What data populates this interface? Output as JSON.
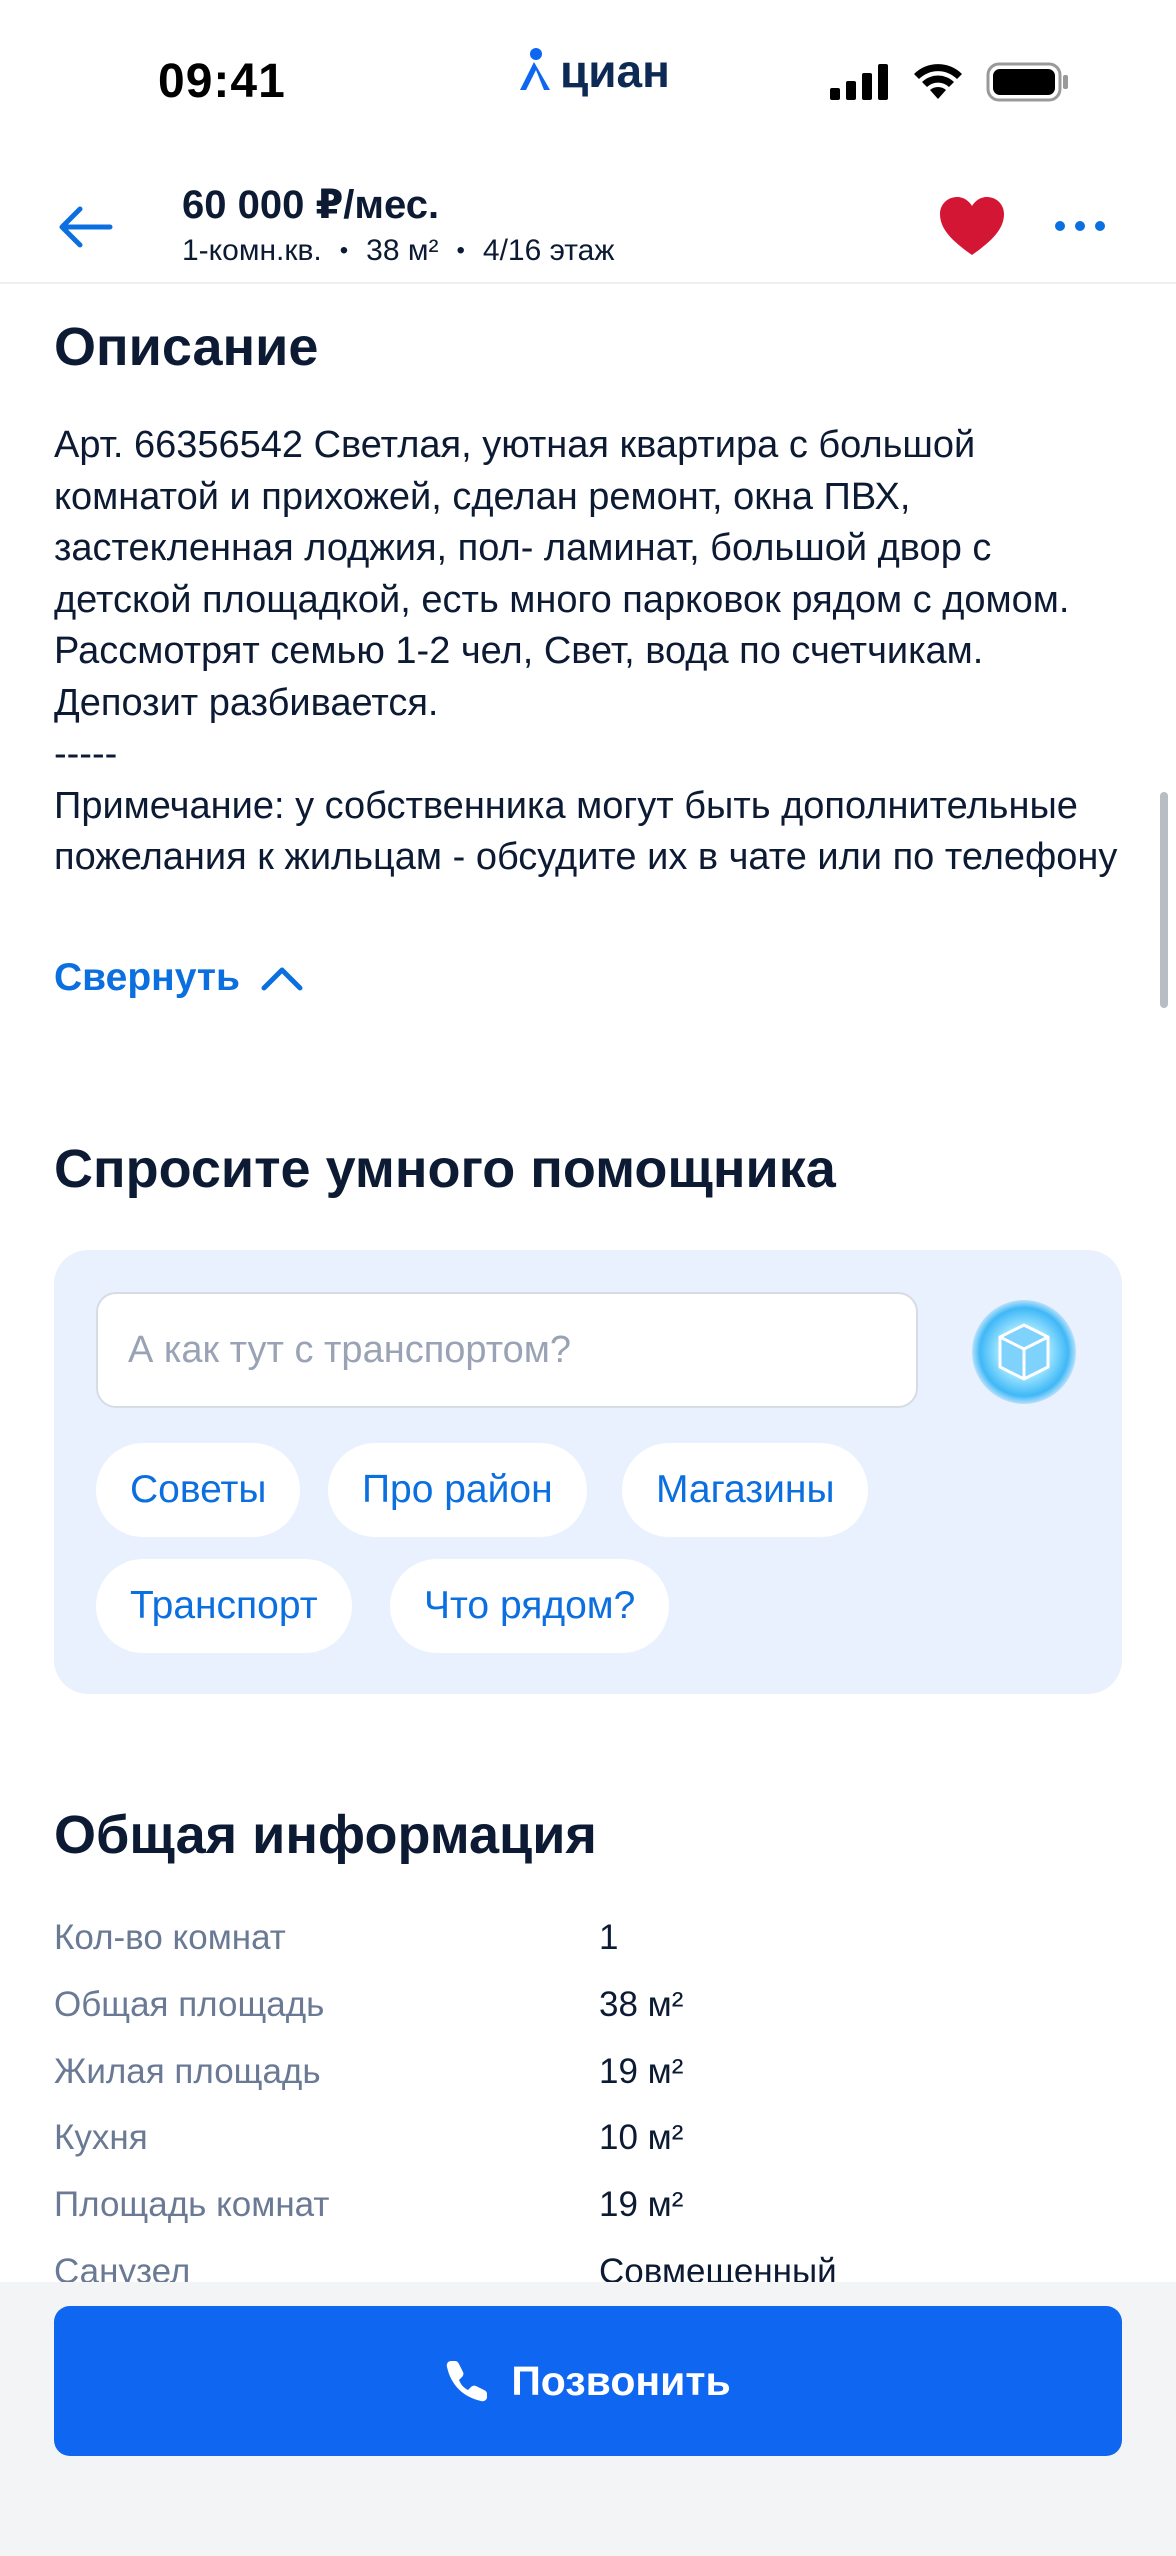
{
  "status_bar": {
    "time": "09:41",
    "brand": "циан"
  },
  "header": {
    "price": "60 000 ₽/мес.",
    "rooms": "1-комн.кв.",
    "area": "38 м²",
    "floor": "4/16 этаж"
  },
  "description": {
    "title": "Описание",
    "text": "Арт. 66356542 Светлая, уютная квартира с большой комнатой и прихожей, сделан ремонт, окна ПВХ, застекленная лоджия, пол- ламинат, большой двор с детской площадкой, есть много парковок рядом с домом. Рассмотрят семью 1-2 чел,  Свет, вода по счетчикам. Депозит разбивается.\n-----\nПримечание: у собственника могут быть дополнительные пожелания к жильцам - обсудите их в чате или по телефону",
    "collapse_label": "Свернуть"
  },
  "assistant": {
    "title": "Спросите умного помощника",
    "input_placeholder": "А как тут с транспортом?",
    "chips": [
      "Советы",
      "Про район",
      "Магазины",
      "Транспорт",
      "Что рядом?"
    ]
  },
  "general_info": {
    "title": "Общая информация",
    "rows": [
      {
        "key": "Кол-во комнат",
        "value": "1"
      },
      {
        "key": "Общая площадь",
        "value": "38 м²"
      },
      {
        "key": "Жилая площадь",
        "value": "19 м²"
      },
      {
        "key": "Кухня",
        "value": "10 м²"
      },
      {
        "key": "Площадь комнат",
        "value": "19 м²"
      },
      {
        "key": "Санузел",
        "value": "Совмещенный"
      }
    ]
  },
  "call_button": {
    "label": "Позвонить"
  },
  "colors": {
    "accent": "#0f66f0",
    "link": "#0c6fe0",
    "favorite": "#d41635",
    "assistant_bg": "#e8f1fd"
  },
  "icons": [
    "cian-logo-icon",
    "signal-icon",
    "wifi-icon",
    "battery-icon",
    "back-arrow-icon",
    "heart-icon",
    "more-dots-icon",
    "chevron-up-icon",
    "assistant-cube-icon",
    "phone-icon"
  ]
}
